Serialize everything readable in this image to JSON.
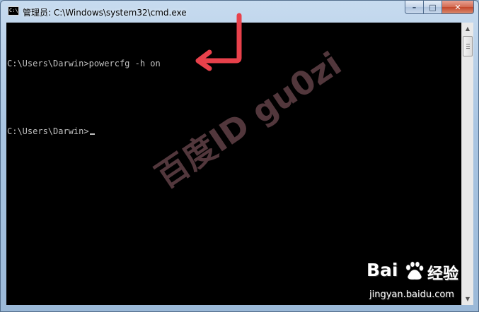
{
  "window": {
    "title": "管理员: C:\\Windows\\system32\\cmd.exe",
    "title_icon": "cmd-icon",
    "icon_glyph": "C:\\",
    "buttons": {
      "minimize": "–",
      "maximize": "□",
      "close": "✕"
    }
  },
  "console": {
    "lines": [
      "C:\\Users\\Darwin>powercfg -h on",
      "C:\\Users\\Darwin>"
    ],
    "background": "#000000",
    "foreground": "#c0c0c0"
  },
  "scrollbar": {
    "up_glyph": "▲",
    "down_glyph": "▼"
  },
  "annotation": {
    "arrow_color": "#e8414b"
  },
  "watermark": {
    "text": "百度ID gu0zi"
  },
  "brand": {
    "wordmark_left": "Bai",
    "wordmark_right": "经验",
    "url": "jingyan.baidu.com"
  }
}
